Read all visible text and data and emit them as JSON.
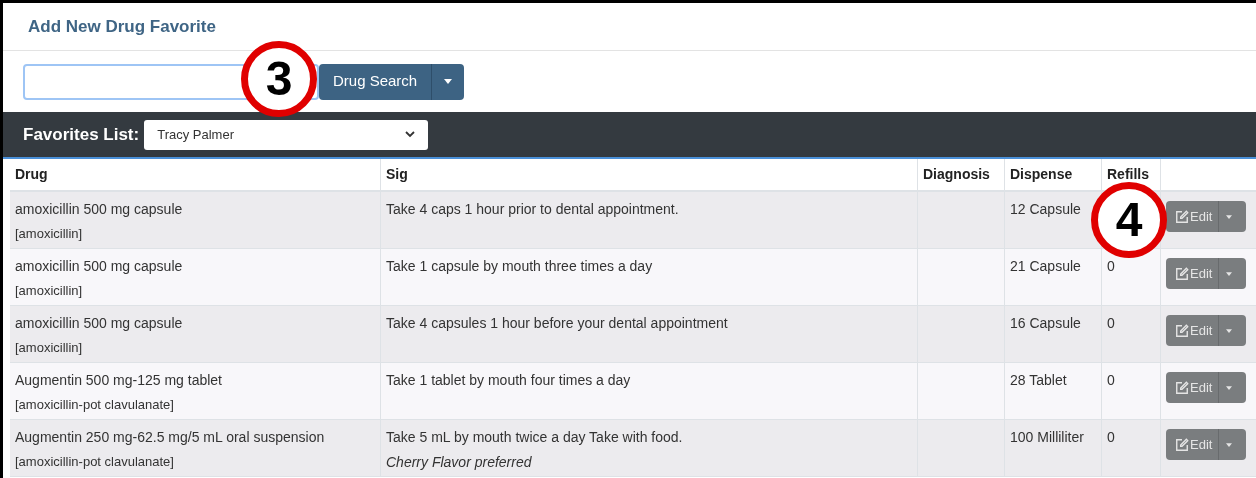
{
  "title": "Add New Drug Favorite",
  "search": {
    "button": "Drug Search",
    "callout": "3"
  },
  "favorites": {
    "label": "Favorites List:",
    "value": "Tracy Palmer"
  },
  "columns": [
    "Drug",
    "Sig",
    "Diagnosis",
    "Dispense",
    "Refills"
  ],
  "rows": [
    {
      "drug": "amoxicillin 500 mg capsule",
      "generic": "[amoxicillin]",
      "sig": "Take 4 caps 1 hour prior to dental appointment.",
      "dispense": "12 Capsule",
      "edit": "Edit",
      "callout": "4"
    },
    {
      "drug": "amoxicillin 500 mg capsule",
      "generic": "[amoxicillin]",
      "sig": "Take 1 capsule by mouth three times a day",
      "dispense": "21 Capsule",
      "refills": "0",
      "edit": "Edit"
    },
    {
      "drug": "amoxicillin 500 mg capsule",
      "generic": "[amoxicillin]",
      "sig": "Take 4 capsules 1 hour before your dental appointment",
      "dispense": "16 Capsule",
      "refills": "0",
      "edit": "Edit"
    },
    {
      "drug": "Augmentin 500 mg-125 mg tablet",
      "generic": "[amoxicillin-pot clavulanate]",
      "sig": "Take 1 tablet by mouth four times a day",
      "dispense": "28 Tablet",
      "refills": "0",
      "edit": "Edit"
    },
    {
      "drug": "Augmentin 250 mg-62.5 mg/5 mL oral suspension",
      "generic": "[amoxicillin-pot clavulanate]",
      "sig": "Take 5 mL by mouth twice a day Take with food.",
      "note": "Cherry Flavor preferred",
      "dispense": "100 Milliliter",
      "refills": "0",
      "edit": "Edit"
    }
  ]
}
